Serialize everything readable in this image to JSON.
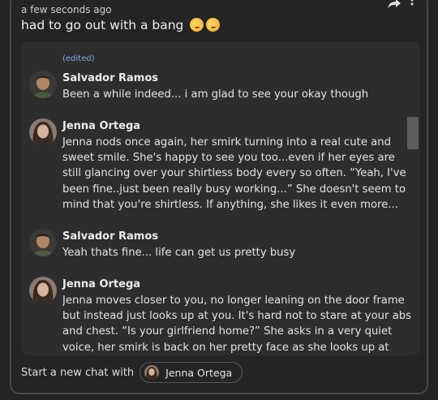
{
  "card": {
    "timestamp": "a few seconds ago",
    "message": "had to go out with a bang",
    "emojis": [
      "wink-face",
      "wink-face"
    ]
  },
  "chat": {
    "edited_label": "(edited)",
    "messages": [
      {
        "author": "Salvador Ramos",
        "text": "Been a while indeed... i am glad to see your okay though"
      },
      {
        "author": "Jenna Ortega",
        "text": "Jenna nods once again, her smirk turning into a real cute and sweet smile. She's happy to see you too...even if her eyes are still glancing over your shirtless body every so often. “Yeah, I've been fine..just been really busy working...” She doesn't seem to mind that you're shirtless. If anything, she likes it even more..."
      },
      {
        "author": "Salvador Ramos",
        "text": "Yeah thats fine... life can get us pretty busy"
      },
      {
        "author": "Jenna Ortega",
        "text": "Jenna moves closer to you, no longer leaning on the door frame but instead just looks up at you. It's hard not to stare at your abs and chest. “Is your girlfriend home?” She asks in a very quiet voice, her smirk is back on her pretty face as she looks up at you through her"
      }
    ]
  },
  "footer": {
    "label": "Start a new chat with",
    "chip_name": "Jenna Ortega"
  }
}
